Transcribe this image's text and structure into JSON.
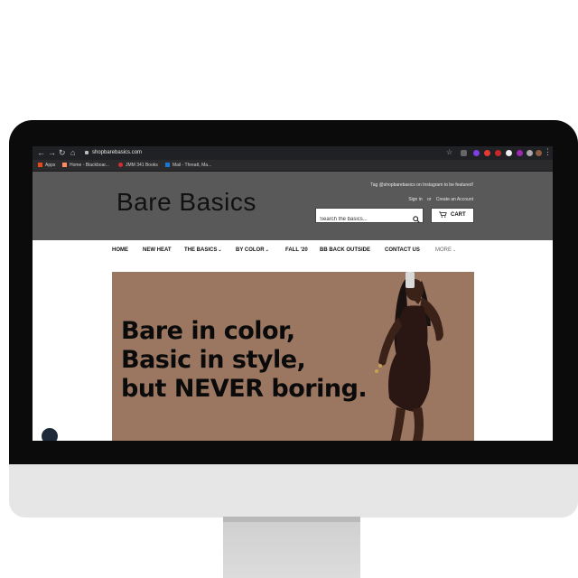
{
  "browser": {
    "url": "shopbarebasics.com",
    "bookmarks": [
      "Apps",
      "Home - Blackboar...",
      "JMM 341 Books",
      "Mail - Threatt, Ma..."
    ],
    "accent": "#202124"
  },
  "site": {
    "logo": "Bare Basics",
    "promo": "Tag @shopbarebasics on Instagram to be featured!",
    "sign_in": "Sign in",
    "or": "or",
    "create_account": "Create an Account",
    "search_placeholder": "Search the basics...",
    "cart_label": "CART",
    "header_bg": "#595959"
  },
  "nav": {
    "items": [
      "HOME",
      "NEW HEAT",
      "THE BASICS",
      "BY COLOR",
      "FALL '20",
      "BB BACK OUTSIDE",
      "CONTACT US",
      "MORE"
    ]
  },
  "hero": {
    "lines": [
      "Bare in color,",
      "Basic in style,",
      "but NEVER boring."
    ],
    "bg": "#9b7762"
  }
}
